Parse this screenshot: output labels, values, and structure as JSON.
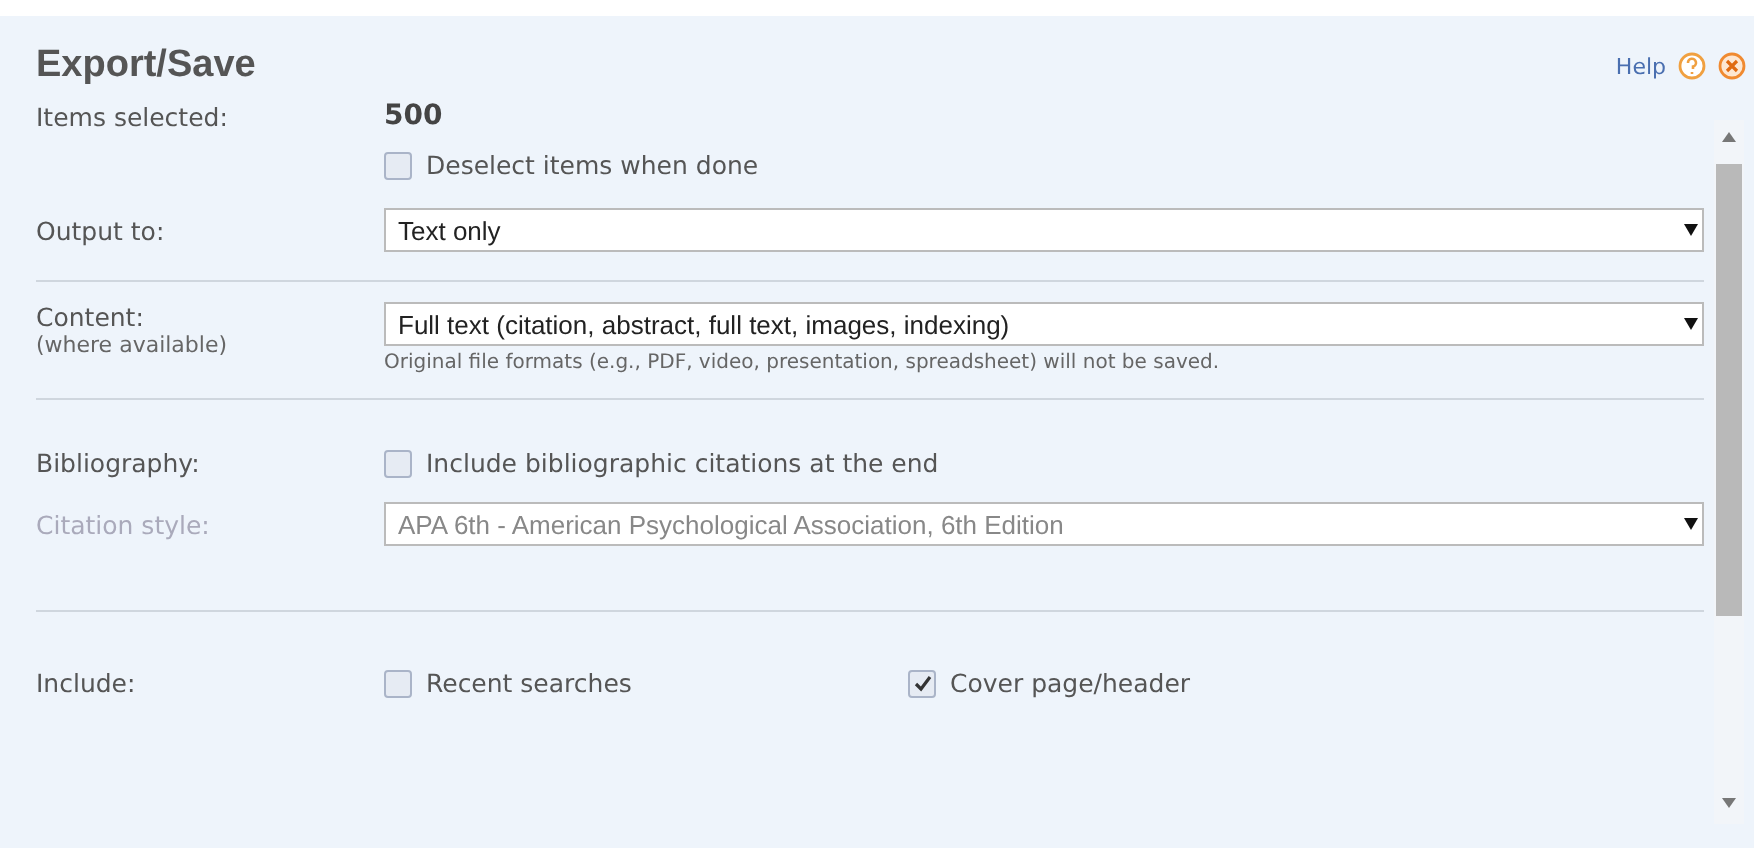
{
  "title": "Export/Save",
  "help": {
    "label": "Help"
  },
  "items_selected": {
    "label": "Items selected:",
    "value": "500"
  },
  "deselect": {
    "label": "Deselect items when done",
    "checked": false
  },
  "output": {
    "label": "Output to:",
    "value": "Text only"
  },
  "content": {
    "label": "Content:",
    "sublabel": "(where available)",
    "value": "Full text (citation, abstract, full text, images, indexing)",
    "note": "Original file formats (e.g., PDF, video, presentation, spreadsheet) will not be saved."
  },
  "bibliography": {
    "label": "Bibliography:",
    "option": {
      "label": "Include bibliographic citations at the end",
      "checked": false
    }
  },
  "citation_style": {
    "label": "Citation style:",
    "value": "APA 6th - American Psychological Association, 6th Edition",
    "disabled": true
  },
  "include": {
    "label": "Include:",
    "options": [
      {
        "label": "Recent searches",
        "checked": false
      },
      {
        "label": "Cover page/header",
        "checked": true
      }
    ]
  }
}
